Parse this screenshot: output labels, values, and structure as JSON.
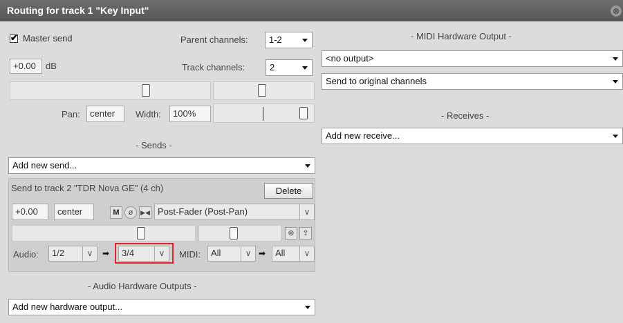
{
  "window": {
    "title": "Routing for track 1 \"Key Input\"",
    "close_glyph": "⊗"
  },
  "master": {
    "master_send_label": "Master send",
    "parent_channels_label": "Parent channels:",
    "parent_channels_value": "1-2",
    "volume_value": "+0.00",
    "volume_unit": "dB",
    "track_channels_label": "Track channels:",
    "track_channels_value": "2",
    "pan_label": "Pan:",
    "pan_value": "center",
    "width_label": "Width:",
    "width_value": "100%"
  },
  "sends": {
    "header": "- Sends -",
    "add_new_send": "Add new send...",
    "send": {
      "title": "Send to track 2 \"TDR Nova GE\" (4 ch)",
      "delete_label": "Delete",
      "volume_value": "+0.00",
      "pan_value": "center",
      "mute_label": "M",
      "mode_value": "Post-Fader (Post-Pan)",
      "audio_label": "Audio:",
      "audio_src": "1/2",
      "audio_dst": "3/4",
      "midi_label": "MIDI:",
      "midi_src": "All",
      "midi_dst": "All",
      "arrow": "➡"
    }
  },
  "audio_hw": {
    "header": "- Audio Hardware Outputs -",
    "add_new": "Add new hardware output..."
  },
  "midi_hw": {
    "header": "- MIDI Hardware Output -",
    "output_value": "<no output>",
    "channel_value": "Send to original channels"
  },
  "receives": {
    "header": "- Receives -",
    "add_new": "Add new receive..."
  }
}
